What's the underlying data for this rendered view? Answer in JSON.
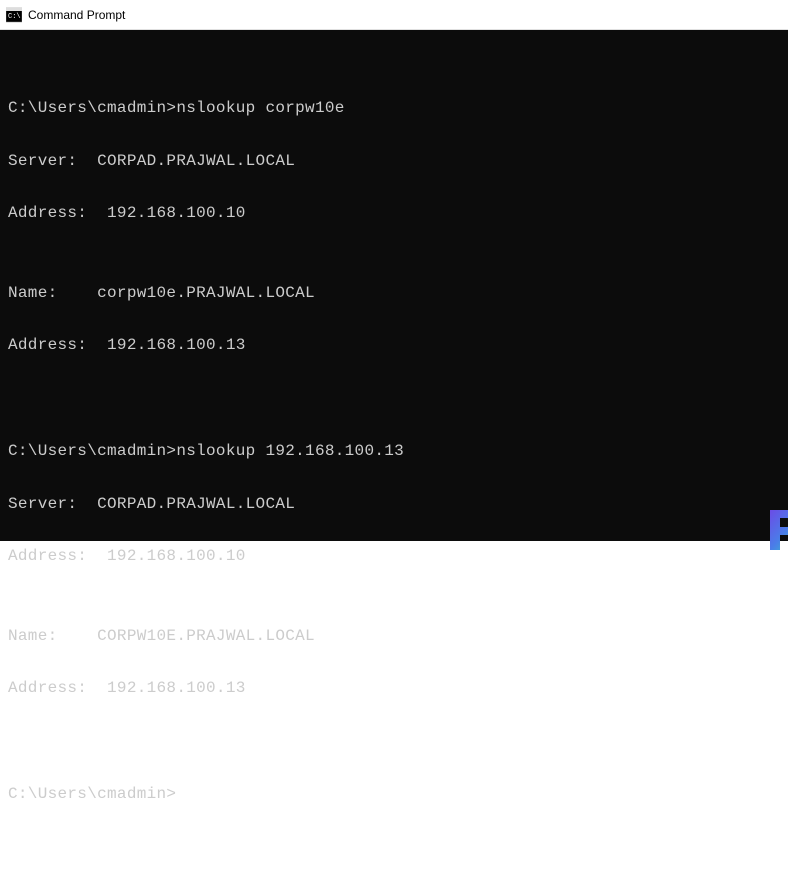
{
  "window": {
    "title": "Command Prompt"
  },
  "terminal": {
    "lines": [
      "",
      "C:\\Users\\cmadmin>nslookup corpw10e",
      "Server:  CORPAD.PRAJWAL.LOCAL",
      "Address:  192.168.100.10",
      "",
      "Name:    corpw10e.PRAJWAL.LOCAL",
      "Address:  192.168.100.13",
      "",
      "",
      "C:\\Users\\cmadmin>nslookup 192.168.100.13",
      "Server:  CORPAD.PRAJWAL.LOCAL",
      "Address:  192.168.100.10",
      "",
      "Name:    CORPW10E.PRAJWAL.LOCAL",
      "Address:  192.168.100.13",
      "",
      "",
      "C:\\Users\\cmadmin>"
    ]
  }
}
